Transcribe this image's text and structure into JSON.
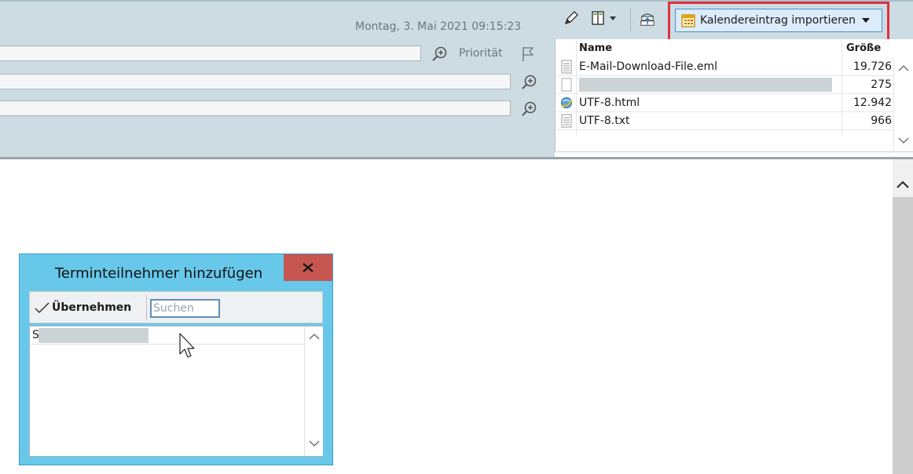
{
  "header": {
    "datetime": "Montag, 3. Mai 2021  09:15:23",
    "priority_label": "Priorität",
    "icons": [
      "zoom-in-icon",
      "flag-icon"
    ]
  },
  "attachments": {
    "toolbar": {
      "icons": [
        "pencil-icon",
        "columns-icon",
        "save-attachment-icon",
        "calendar-icon",
        "chevron-down-icon"
      ],
      "import_label": "Kalendereintrag importieren"
    },
    "columns": {
      "name": "Name",
      "size": "Größe"
    },
    "rows": [
      {
        "name": "E-Mail-Download-File.eml",
        "size": "19.726",
        "icon": "text-file-icon"
      },
      {
        "name": "",
        "size": "275",
        "icon": "blank-file-icon"
      },
      {
        "name": "UTF-8.html",
        "size": "12.942",
        "icon": "html-file-icon"
      },
      {
        "name": "UTF-8.txt",
        "size": "966",
        "icon": "text-file-icon"
      }
    ]
  },
  "dialog": {
    "title": "Terminteilnehmer hinzufügen",
    "close_label": "x",
    "apply_label": "Übernehmen",
    "search_placeholder": "Suchen",
    "list_items": [
      "S"
    ]
  },
  "colors": {
    "header_bg": "#cddce3",
    "dialog_bg": "#67c8ea",
    "close_bg": "#c85650",
    "highlight": "#e0313a",
    "import_btn_bg": "#dcecfa"
  }
}
